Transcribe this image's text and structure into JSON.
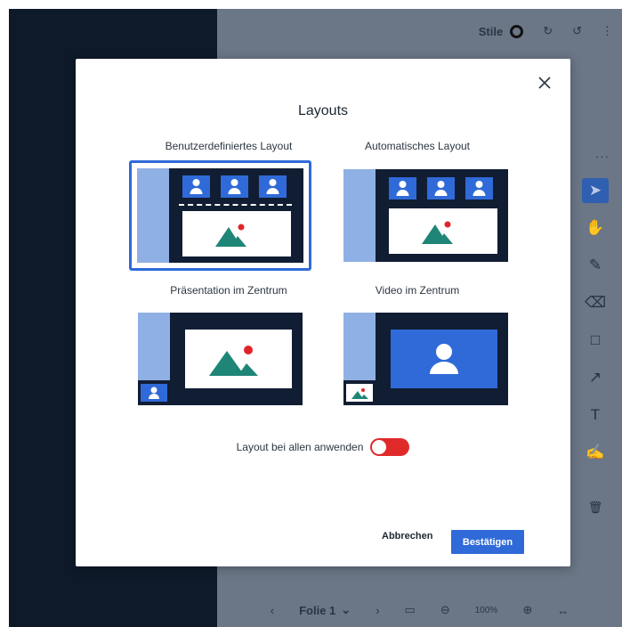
{
  "app": {
    "topbar": {
      "styles_label": "Stile"
    },
    "bottombar": {
      "slide_label": "Folie 1",
      "zoom": "100%"
    }
  },
  "dialog": {
    "title": "Layouts",
    "options": [
      {
        "label": "Benutzerdefiniertes Layout",
        "selected": true
      },
      {
        "label": "Automatisches Layout",
        "selected": false
      },
      {
        "label": "Präsentation im Zentrum",
        "selected": false
      },
      {
        "label": "Video im Zentrum",
        "selected": false
      }
    ],
    "toggle": {
      "label": "Layout bei allen anwenden",
      "on": false
    },
    "cancel_label": "Abbrechen",
    "confirm_label": "Bestätigen"
  },
  "colors": {
    "accent": "#2f6ad8",
    "thumb_bg": "#111d33",
    "thumb_side": "#8fb0e4",
    "mountain": "#1f8577",
    "sun": "#e0242a",
    "toggle_off": "#e02a2a"
  }
}
